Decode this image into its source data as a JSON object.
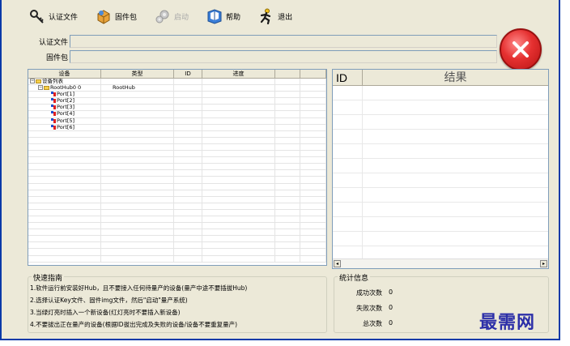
{
  "toolbar": {
    "auth_file": "认证文件",
    "firmware": "固件包",
    "start": "启动",
    "help": "帮助",
    "exit": "退出"
  },
  "fields": {
    "auth_file_label": "认证文件",
    "firmware_label": "固件包",
    "auth_file_value": "",
    "firmware_value": ""
  },
  "device_table": {
    "headers": [
      "设备",
      "类型",
      "ID",
      "进度"
    ],
    "rows": [
      {
        "name": "设备列表",
        "type": ""
      },
      {
        "name": "RootHub0 0",
        "type": "RootHub"
      },
      {
        "name": "Port[1]",
        "type": ""
      },
      {
        "name": "Port[2]",
        "type": ""
      },
      {
        "name": "Port[3]",
        "type": ""
      },
      {
        "name": "Port[4]",
        "type": ""
      },
      {
        "name": "Port[5]",
        "type": ""
      },
      {
        "name": "Port[6]",
        "type": ""
      }
    ]
  },
  "result_table": {
    "id_header": "ID",
    "result_header": "结果"
  },
  "guide": {
    "title": "快速指南",
    "lines": [
      "1.软件运行前安装好Hub，且不要接入任何待量产的设备(量产中途不要插拔Hub)",
      "2.选择认证Key文件、固件img文件，然后\"启动\"量产系统)",
      "3.当绿灯亮时插入一个新设备(红灯亮时不要插入新设备)",
      "4.不要拔出正在量产的设备(根据ID拔出完成及失败的设备/设备不要重复量产)"
    ]
  },
  "stats": {
    "title": "统计信息",
    "success_label": "成功次数",
    "success_value": "0",
    "fail_label": "失败次数",
    "fail_value": "0",
    "total_label": "总次数",
    "total_value": "0"
  },
  "watermark": "最需网",
  "colors": {
    "window_bg": "#ece9d8",
    "border": "#0a3aa8",
    "close_red": "#e53030",
    "watermark": "#2c2fa8"
  }
}
